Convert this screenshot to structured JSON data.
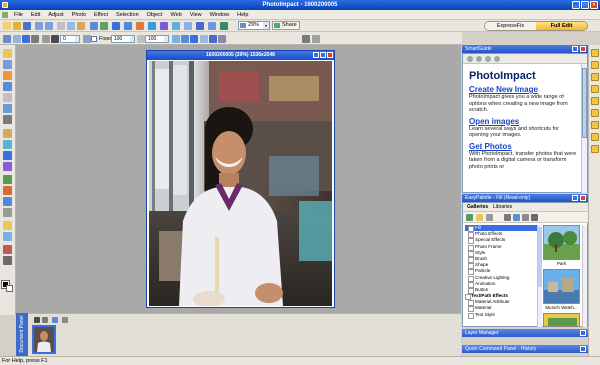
{
  "window": {
    "title": "PhotoImpact - 1600200005"
  },
  "menu": [
    "File",
    "Edit",
    "Adjust",
    "Photo",
    "Effect",
    "Selection",
    "Object",
    "Web",
    "View",
    "Window",
    "Help"
  ],
  "toolbar": {
    "zoom_value": "29%",
    "share_label": "Share",
    "mode_tabs": {
      "expressfix": "ExpressFix",
      "fulledit": "Full Edit"
    }
  },
  "attributes": {
    "field1": "0",
    "fixed_label": "Fixed",
    "width_value": "100",
    "height_value": "100"
  },
  "document": {
    "title": "1600200005 (29%) 1536x2048"
  },
  "smartguide": {
    "panel_title": "SmartGuide",
    "heading": "PhotoImpact",
    "sections": [
      {
        "link": "Create New Image",
        "text": "PhotoImpact gives you a wide range of options when creating a new image from scratch."
      },
      {
        "link": "Open images",
        "text": "Learn several ways and shortcuts for opening your images."
      },
      {
        "link": "Get Photos",
        "text": "With PhotoImpact, transfer photos that were taken from a digital camera or transform photo prints or"
      }
    ]
  },
  "easypalette": {
    "panel_title": "EasyPalette - Fill (Read-only)",
    "tabs": [
      "Galleries",
      "Libraries"
    ],
    "tree": [
      {
        "label": "Fill",
        "selected": true,
        "group": false
      },
      {
        "label": "Photo Effects",
        "selected": false,
        "group": false
      },
      {
        "label": "Special Effects",
        "selected": false,
        "group": false
      },
      {
        "label": "Photo Frame",
        "selected": false,
        "group": false
      },
      {
        "label": "Style",
        "selected": false,
        "group": false
      },
      {
        "label": "Brush",
        "selected": false,
        "group": false
      },
      {
        "label": "Shape",
        "selected": false,
        "group": false
      },
      {
        "label": "Particle",
        "selected": false,
        "group": false
      },
      {
        "label": "Creative Lighting",
        "selected": false,
        "group": false
      },
      {
        "label": "Animation",
        "selected": false,
        "group": false
      },
      {
        "label": "Button",
        "selected": false,
        "group": false
      },
      {
        "label": "Text/Path Effects",
        "selected": false,
        "group": true
      },
      {
        "label": "Material Attribute",
        "selected": false,
        "group": false
      },
      {
        "label": "Material",
        "selected": false,
        "group": false
      },
      {
        "label": "Text Style",
        "selected": false,
        "group": false
      }
    ],
    "gallery": [
      {
        "label": "Park"
      },
      {
        "label": "Munich Wateh..."
      }
    ]
  },
  "panels": {
    "layer_manager": "Layer Manager",
    "quick_command": "Quick Command Panel - History"
  },
  "filmstrip": {
    "label": "Document Panel"
  },
  "statusbar": {
    "text": "For Help, press F1"
  },
  "colors": {
    "title_blue": "#0a3fb8",
    "accent_gold": "#f5b82a",
    "workspace_gray": "#a9a9a9"
  }
}
